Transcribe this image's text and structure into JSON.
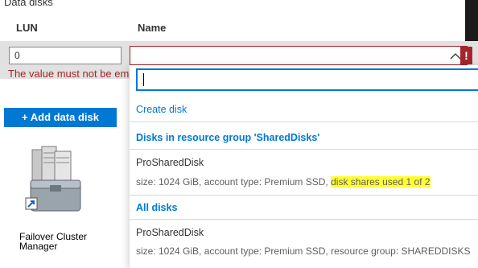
{
  "section_title": "Data disks",
  "table": {
    "headers": [
      "LUN",
      "Name"
    ]
  },
  "row": {
    "lun_value": "0",
    "name_value": "",
    "error_badge": "!",
    "validation_message": "The value must not be empty"
  },
  "buttons": {
    "add_data_disk": "+ Add data disk"
  },
  "dropdown": {
    "search_value": "",
    "create_label": "Create disk",
    "groups": [
      {
        "header": "Disks in resource group 'SharedDisks'",
        "disks": [
          {
            "name": "ProSharedDisk",
            "meta_prefix": "size: 1024 GiB, account type: Premium SSD, ",
            "meta_highlight": "disk shares used 1 of 2"
          }
        ]
      },
      {
        "header": "All disks",
        "disks": [
          {
            "name": "ProSharedDisk",
            "meta_prefix": "size: 1024 GiB, account type: Premium SSD, resource group: SHAREDDISKS",
            "meta_highlight": ""
          }
        ]
      }
    ]
  },
  "desktop_icon": {
    "label": "Failover Cluster Manager"
  },
  "colors": {
    "accent": "#0078d4",
    "error": "#a4262c",
    "highlight": "#ffff33",
    "row_background": "#e1e1e1"
  }
}
